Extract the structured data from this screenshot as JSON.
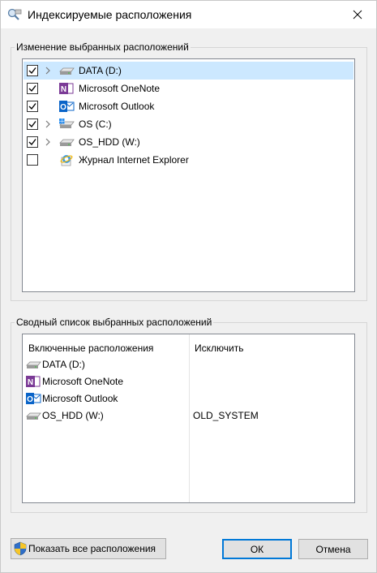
{
  "window": {
    "title": "Индексируемые расположения"
  },
  "change_group": {
    "legend": "Изменение выбранных расположений",
    "items": [
      {
        "label": "DATA (D:)",
        "checked": true,
        "expandable": true,
        "selected": true,
        "icon": "drive-icon"
      },
      {
        "label": "Microsoft OneNote",
        "checked": true,
        "expandable": false,
        "selected": false,
        "icon": "onenote-icon"
      },
      {
        "label": "Microsoft Outlook",
        "checked": true,
        "expandable": false,
        "selected": false,
        "icon": "outlook-icon"
      },
      {
        "label": "OS (C:)",
        "checked": true,
        "expandable": true,
        "selected": false,
        "icon": "windows-drive-icon"
      },
      {
        "label": "OS_HDD (W:)",
        "checked": true,
        "expandable": true,
        "selected": false,
        "icon": "drive-icon"
      },
      {
        "label": "Журнал Internet Explorer",
        "checked": false,
        "expandable": false,
        "selected": false,
        "icon": "internet-explorer-icon"
      }
    ]
  },
  "summary_group": {
    "legend": "Сводный список выбранных расположений",
    "columns": {
      "included": "Включенные расположения",
      "exclude": "Исключить"
    },
    "rows": [
      {
        "location": "DATA (D:)",
        "exclude": "",
        "icon": "drive-icon"
      },
      {
        "location": "Microsoft OneNote",
        "exclude": "",
        "icon": "onenote-icon"
      },
      {
        "location": "Microsoft Outlook",
        "exclude": "",
        "icon": "outlook-icon"
      },
      {
        "location": "OS_HDD (W:)",
        "exclude": "OLD_SYSTEM",
        "icon": "drive-icon"
      }
    ]
  },
  "buttons": {
    "show_all": "Показать все расположения",
    "ok": "ОК",
    "cancel": "Отмена"
  },
  "colors": {
    "selection": "#cce8ff",
    "default_button_border": "#0078d7",
    "onenote": "#7b3a96",
    "outlook": "#0a64c8"
  }
}
